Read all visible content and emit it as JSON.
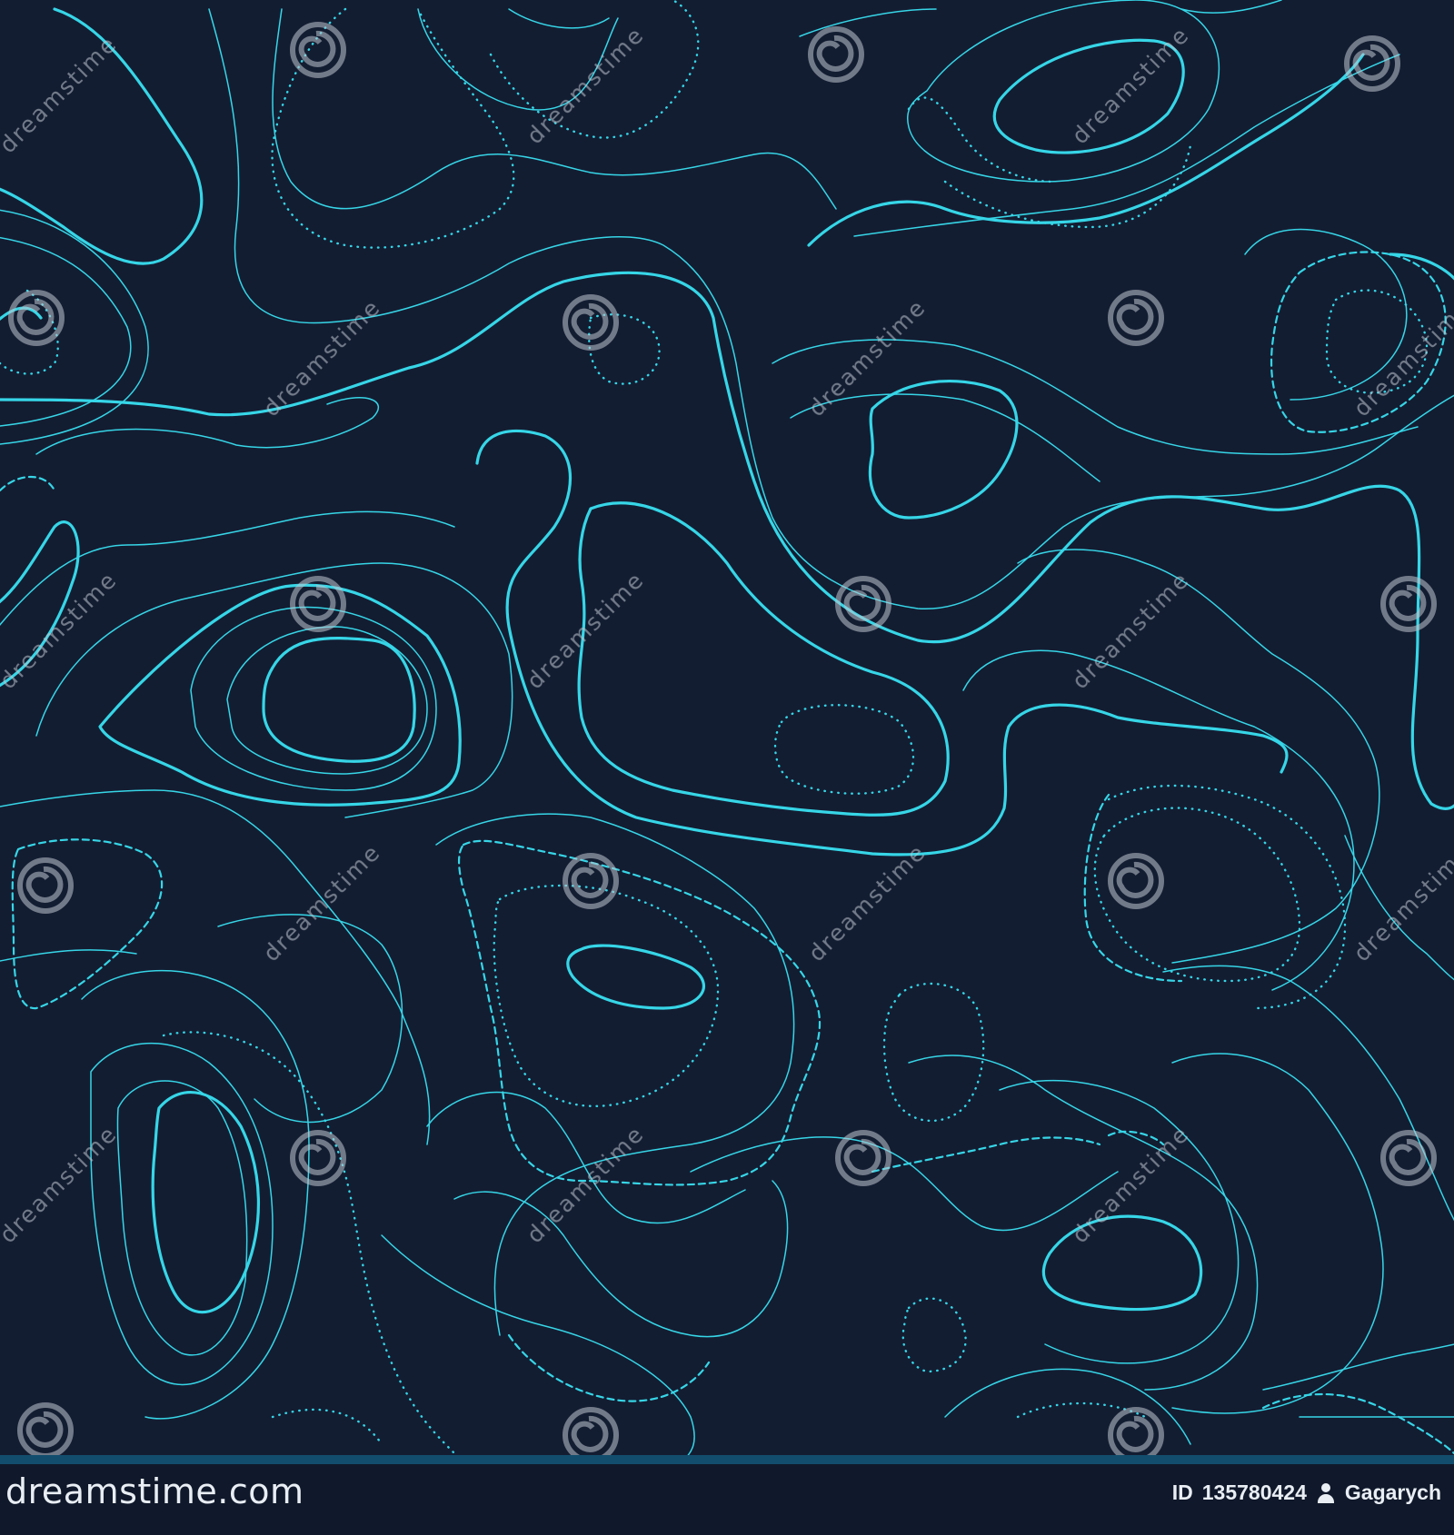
{
  "colors": {
    "background": "#131d32",
    "contour": "#36d6e7",
    "watermark": "#bfc6cf",
    "footer_background": "#10192b",
    "footer_text": "#e9eef4"
  },
  "watermark": {
    "text": "dreamstime",
    "icon": "spiral-logo-icon"
  },
  "footer": {
    "brand": "dreamstime.com",
    "id_label": "ID",
    "id_value": "135780424",
    "author_icon": "user-icon",
    "author": "Gagarych"
  }
}
